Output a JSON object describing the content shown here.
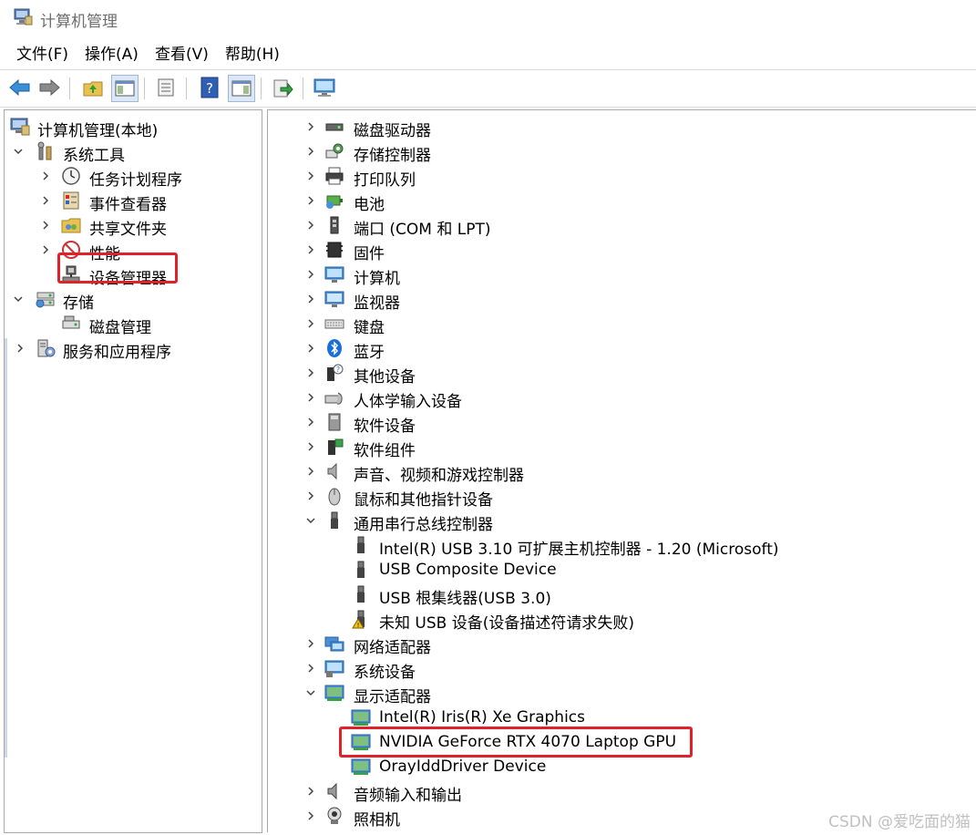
{
  "window": {
    "title": "计算机管理"
  },
  "menu": {
    "file": "文件(F)",
    "action": "操作(A)",
    "view": "查看(V)",
    "help": "帮助(H)"
  },
  "toolbar": {
    "icons": [
      "back-arrow-icon",
      "forward-arrow-icon",
      "up-folder-icon",
      "show-hide-tree-icon",
      "properties-icon",
      "help-icon",
      "action-pane-icon",
      "export-icon",
      "monitor-icon"
    ]
  },
  "left_tree": {
    "root": "计算机管理(本地)",
    "system_tools": "系统工具",
    "task_scheduler": "任务计划程序",
    "event_viewer": "事件查看器",
    "shared_folders": "共享文件夹",
    "performance": "性能",
    "device_manager": "设备管理器",
    "storage": "存储",
    "disk_management": "磁盘管理",
    "services_apps": "服务和应用程序"
  },
  "devices": {
    "disk_drives": "磁盘驱动器",
    "storage_controllers": "存储控制器",
    "print_queues": "打印队列",
    "batteries": "电池",
    "ports": "端口 (COM 和 LPT)",
    "firmware": "固件",
    "computer": "计算机",
    "monitors": "监视器",
    "keyboards": "键盘",
    "bluetooth": "蓝牙",
    "other_devices": "其他设备",
    "hid": "人体学输入设备",
    "software_devices": "软件设备",
    "software_components": "软件组件",
    "sound": "声音、视频和游戏控制器",
    "mice": "鼠标和其他指针设备",
    "usb": "通用串行总线控制器",
    "usb_children": [
      "Intel(R) USB 3.10 可扩展主机控制器 - 1.20 (Microsoft)",
      "USB Composite Device",
      "USB 根集线器(USB 3.0)",
      "未知 USB 设备(设备描述符请求失败)"
    ],
    "network": "网络适配器",
    "system_devices": "系统设备",
    "display": "显示适配器",
    "display_children": [
      "Intel(R) Iris(R) Xe Graphics",
      "NVIDIA GeForce RTX 4070 Laptop GPU",
      "OrayIddDriver Device"
    ],
    "audio_io": "音频输入和输出",
    "cameras": "照相机"
  },
  "watermark": "CSDN @爱吃面的猫",
  "colors": {
    "highlight_box": "#e0202a",
    "title_gray": "#6d6d6d"
  }
}
